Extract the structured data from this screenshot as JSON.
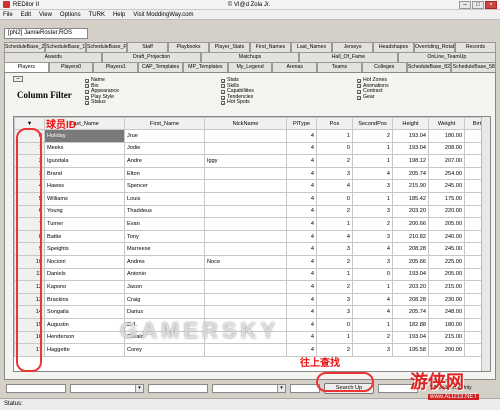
{
  "window": {
    "title": "REDitor II",
    "credit": "© VI@d Zola Jr."
  },
  "menu": [
    "File",
    "Edit",
    "View",
    "Options",
    "TURK",
    "Help",
    "Visit ModdingWay.com"
  ],
  "file_tab": "[pN2] JamieRoster.ROS",
  "tab_rows": [
    [
      "ScheduleBase_29",
      "ScheduleBase_14",
      "ScheduleBase_PreSeason",
      "Staff",
      "Playbooks",
      "Player_Stats",
      "First_Names",
      "Last_Names",
      "Jerseys",
      "Headshapes",
      "Overriding_Rotations",
      "Records"
    ],
    [
      "Awards",
      "Draft_Projection",
      "Matchups",
      "Hall_Of_Fame",
      "OnLine_TeamUp"
    ],
    [
      "Players",
      "Players0",
      "Players1",
      "CAP_Templates",
      "MP_Templates",
      "My_Legend",
      "Arenas",
      "Teams",
      "Colleges",
      "ScheduleBase_82",
      "ScheduleBase_58"
    ]
  ],
  "filter": {
    "collapse": "–",
    "title": "Column Filter",
    "col1": [
      "Name",
      "Bio",
      "Appearance",
      "Play Style",
      "Status"
    ],
    "col2": [
      "Stats",
      "Skills",
      "Capabilities",
      "Tendencies",
      "Hot Spots"
    ],
    "col3": [
      "Hot Zones",
      "Animations",
      "Contract",
      "Gear"
    ]
  },
  "table": {
    "headers": [
      "",
      "Last_Name",
      "First_Name",
      "NickName",
      "PlType",
      "Pos",
      "SecondPos",
      "Height",
      "Weight",
      "Birth"
    ],
    "rows": [
      [
        "0",
        "Holiday",
        "Jrue",
        "",
        "4",
        "1",
        "2",
        "193.04",
        "180.00"
      ],
      [
        "1",
        "Meeks",
        "Jodie",
        "",
        "4",
        "0",
        "1",
        "193.04",
        "208.00"
      ],
      [
        "2",
        "Iguodala",
        "Andre",
        "Iggy",
        "4",
        "2",
        "1",
        "198.12",
        "207.00"
      ],
      [
        "3",
        "Brand",
        "Elton",
        "",
        "4",
        "3",
        "4",
        "205.74",
        "254.00"
      ],
      [
        "4",
        "Hawes",
        "Spencer",
        "",
        "4",
        "4",
        "3",
        "215.90",
        "245.00"
      ],
      [
        "5",
        "Williams",
        "Louis",
        "",
        "4",
        "0",
        "1",
        "185.42",
        "175.00"
      ],
      [
        "6",
        "Young",
        "Thaddeus",
        "",
        "4",
        "2",
        "3",
        "203.20",
        "220.00"
      ],
      [
        "7",
        "Turner",
        "Evan",
        "",
        "4",
        "1",
        "2",
        "200.66",
        "205.00"
      ],
      [
        "8",
        "Battie",
        "Tony",
        "",
        "4",
        "4",
        "3",
        "210.82",
        "240.00"
      ],
      [
        "9",
        "Speights",
        "Marreese",
        "",
        "4",
        "3",
        "4",
        "208.28",
        "245.00"
      ],
      [
        "10",
        "Nocioni",
        "Andres",
        "Noce",
        "4",
        "2",
        "3",
        "205.66",
        "225.00"
      ],
      [
        "11",
        "Daniels",
        "Antonio",
        "",
        "4",
        "1",
        "0",
        "193.04",
        "205.00"
      ],
      [
        "12",
        "Kapono",
        "Jason",
        "",
        "4",
        "2",
        "1",
        "203.20",
        "215.00"
      ],
      [
        "13",
        "Brackins",
        "Craig",
        "",
        "4",
        "3",
        "4",
        "208.28",
        "230.00"
      ],
      [
        "14",
        "Songaila",
        "Darius",
        "",
        "4",
        "3",
        "4",
        "205.74",
        "248.00"
      ],
      [
        "15",
        "Augustin",
        "D.J.",
        "",
        "4",
        "0",
        "1",
        "182.88",
        "180.00"
      ],
      [
        "16",
        "Henderson",
        "Gerald",
        "",
        "4",
        "1",
        "2",
        "193.04",
        "215.00"
      ],
      [
        "17",
        "Haggette",
        "Corey",
        "",
        "4",
        "2",
        "3",
        "195.58",
        "200.00"
      ]
    ]
  },
  "bottom": {
    "search_label": "Search Up",
    "whole_words": "Whole Words Only"
  },
  "status": "Status:",
  "annotations": {
    "id_note": "球员ID",
    "search_note": "往上查找"
  },
  "watermark": "GAMERSKY",
  "logo": {
    "text": "游侠网",
    "url": "www.ALI213.NET"
  }
}
